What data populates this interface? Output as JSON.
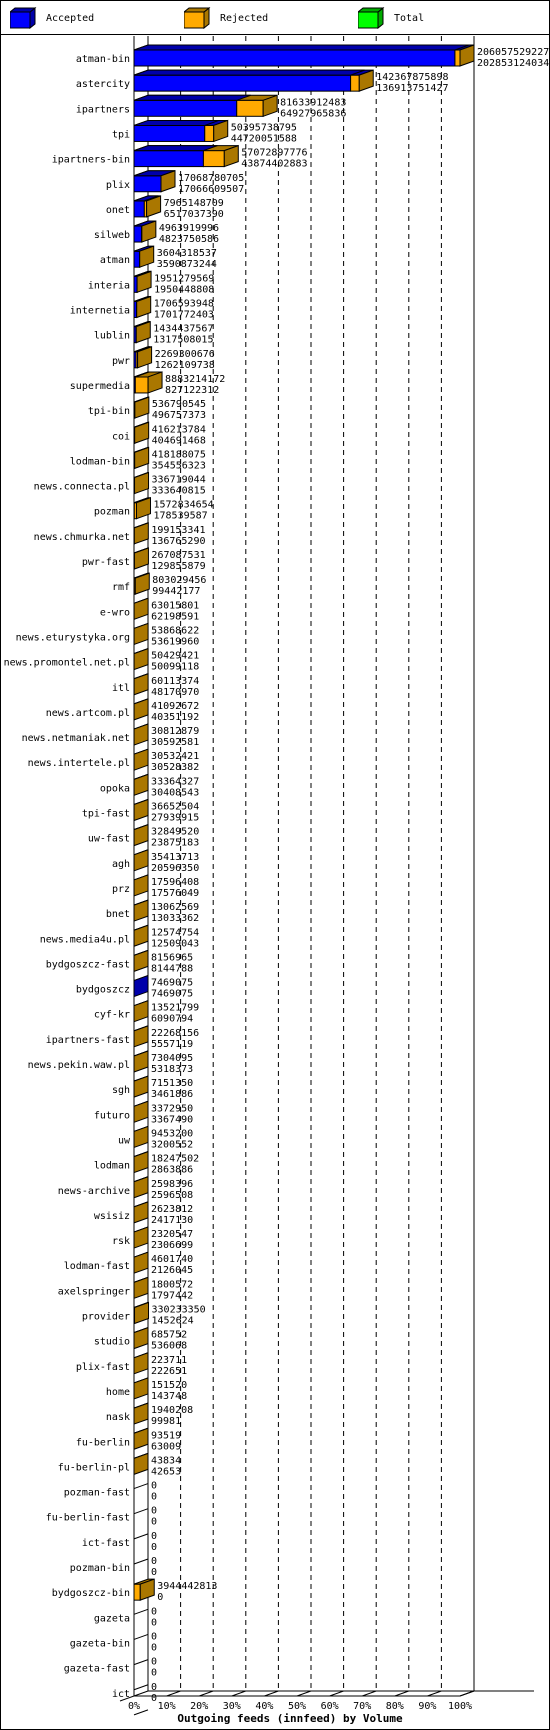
{
  "legend": [
    {
      "label": "Accepted",
      "color": "#0000ff",
      "shade": "#0000aa"
    },
    {
      "label": "Rejected",
      "color": "#ffaa00",
      "shade": "#aa7700"
    },
    {
      "label": "Total",
      "color": "#00ff00",
      "shade": "#00aa00"
    }
  ],
  "chart_data": {
    "type": "bar",
    "orientation": "horizontal",
    "stacked": true,
    "title": "Outgoing feeds (innfeed) by Volume",
    "xlabel": "Outgoing feeds (innfeed) by Volume",
    "ylabel": "",
    "xlim": [
      0,
      100
    ],
    "x_unit": "%",
    "x_ticks": [
      "0%",
      "10%",
      "20%",
      "30%",
      "40%",
      "50%",
      "60%",
      "70%",
      "80%",
      "90%",
      "100%"
    ],
    "grid": true,
    "legend_position": "top",
    "categories": [
      "atman-bin",
      "astercity",
      "ipartners",
      "tpi",
      "ipartners-bin",
      "plix",
      "onet",
      "silweb",
      "atman",
      "interia",
      "internetia",
      "lublin",
      "pwr",
      "supermedia",
      "tpi-bin",
      "coi",
      "lodman-bin",
      "news.connecta.pl",
      "pozman",
      "news.chmurka.net",
      "pwr-fast",
      "rmf",
      "e-wro",
      "news.eturystyka.org",
      "news.promontel.net.pl",
      "itl",
      "news.artcom.pl",
      "news.netmaniak.net",
      "news.intertele.pl",
      "opoka",
      "tpi-fast",
      "uw-fast",
      "agh",
      "prz",
      "bnet",
      "news.media4u.pl",
      "bydgoszcz-fast",
      "bydgoszcz",
      "cyf-kr",
      "ipartners-fast",
      "news.pekin.waw.pl",
      "sgh",
      "futuro",
      "uw",
      "lodman",
      "news-archive",
      "wsisiz",
      "rsk",
      "lodman-fast",
      "axelspringer",
      "provider",
      "studio",
      "plix-fast",
      "home",
      "nask",
      "fu-berlin",
      "fu-berlin-pl",
      "pozman-fast",
      "fu-berlin-fast",
      "ict-fast",
      "pozman-bin",
      "bydgoszcz-bin",
      "gazeta",
      "gazeta-bin",
      "gazeta-fast",
      "ict"
    ],
    "total_labels": [
      "206057529227",
      "142367875898",
      "81633912483",
      "50395738795",
      "57072897776",
      "17068780705",
      "7965148709",
      "4963919996",
      "3604318537",
      "1951279569",
      "1706593948",
      "1434437567",
      "2269300676",
      "8883214172",
      "536790545",
      "416213784",
      "418188075",
      "336719044",
      "1572834654",
      "199153341",
      "267087531",
      "803029456",
      "63015801",
      "53868622",
      "50429421",
      "60113374",
      "41092672",
      "30812879",
      "30532421",
      "33364327",
      "36652504",
      "32849520",
      "35413713",
      "17596408",
      "13062569",
      "12574754",
      "8156965",
      "7469075",
      "13521799",
      "22268156",
      "7304095",
      "7151350",
      "3372950",
      "9453200",
      "18247502",
      "2598396",
      "2623812",
      "2320547",
      "4601740",
      "1800572",
      "330233350",
      "685752",
      "223711",
      "151520",
      "1940208",
      "93519",
      "43834",
      "0",
      "0",
      "0",
      "0",
      "3944442813",
      "0",
      "0",
      "0",
      "0"
    ],
    "accepted_labels": [
      "202853124034",
      "136913751427",
      "64927965836",
      "44720051588",
      "43874402883",
      "17066609507",
      "6517037390",
      "4823750586",
      "3590873244",
      "1950448808",
      "1701772403",
      "1317508015",
      "1262109738",
      "827122312",
      "496757373",
      "404691468",
      "354556323",
      "333640815",
      "178539587",
      "136765290",
      "129855879",
      "99442177",
      "62198591",
      "53619960",
      "50099118",
      "48170970",
      "40351192",
      "30592581",
      "30528382",
      "30408543",
      "27939915",
      "23875183",
      "20596350",
      "17576049",
      "13033362",
      "12509043",
      "8144788",
      "7469075",
      "6090794",
      "5557119",
      "5318373",
      "3461886",
      "3367490",
      "3200552",
      "2863886",
      "2596508",
      "2417130",
      "2306699",
      "2126045",
      "1797442",
      "1452624",
      "536068",
      "222651",
      "143748",
      "99981",
      "63009",
      "42653",
      "0",
      "0",
      "0",
      "0",
      "0",
      "0",
      "0",
      "0",
      "0"
    ],
    "series": [
      {
        "name": "Accepted",
        "values": [
          202853124034,
          136913751427,
          64927965836,
          44720051588,
          43874402883,
          17066609507,
          6517037390,
          4823750586,
          3590873244,
          1950448808,
          1701772403,
          1317508015,
          1262109738,
          827122312,
          496757373,
          404691468,
          354556323,
          333640815,
          178539587,
          136765290,
          129855879,
          99442177,
          62198591,
          53619960,
          50099118,
          48170970,
          40351192,
          30592581,
          30528382,
          30408543,
          27939915,
          23875183,
          20596350,
          17576049,
          13033362,
          12509043,
          8144788,
          7469075,
          6090794,
          5557119,
          5318373,
          3461886,
          3367490,
          3200552,
          2863886,
          2596508,
          2417130,
          2306699,
          2126045,
          1797442,
          1452624,
          536068,
          222651,
          143748,
          99981,
          63009,
          42653,
          0,
          0,
          0,
          0,
          0,
          0,
          0,
          0,
          0
        ]
      },
      {
        "name": "Total",
        "values": [
          206057529227,
          142367875898,
          81633912483,
          50395738795,
          57072897776,
          17068780705,
          7965148709,
          4963919996,
          3604318537,
          1951279569,
          1706593948,
          1434437567,
          2269300676,
          8883214172,
          536790545,
          416213784,
          418188075,
          336719044,
          1572834654,
          199153341,
          267087531,
          803029456,
          63015801,
          53868622,
          50429421,
          60113374,
          41092672,
          30812879,
          30532421,
          33364327,
          36652504,
          32849520,
          35413713,
          17596408,
          13062569,
          12574754,
          8156965,
          7469075,
          13521799,
          22268156,
          7304095,
          7151350,
          3372950,
          9453200,
          18247502,
          2598396,
          2623812,
          2320547,
          4601740,
          1800572,
          330233350,
          685752,
          223711,
          151520,
          1940208,
          93519,
          43834,
          0,
          0,
          0,
          0,
          3944442813,
          0,
          0,
          0,
          0
        ]
      }
    ]
  }
}
